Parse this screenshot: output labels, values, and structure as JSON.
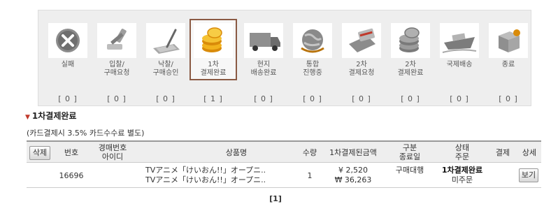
{
  "steps": [
    {
      "label": "실패",
      "count": "[ 0 ]",
      "icon": "cancel-icon"
    },
    {
      "label": "입찰/\n구매요청",
      "count": "[ 0 ]",
      "icon": "gavel-icon"
    },
    {
      "label": "낙찰/\n구매승인",
      "count": "[ 0 ]",
      "icon": "pen-tablet-icon"
    },
    {
      "label": "1차\n결제완료",
      "count": "[ 1 ]",
      "icon": "coins-icon"
    },
    {
      "label": "현지\n배송완료",
      "count": "[ 0 ]",
      "icon": "truck-icon"
    },
    {
      "label": "통합\n진행중",
      "count": "[ 0 ]",
      "icon": "globe-icon"
    },
    {
      "label": "2차\n결제요청",
      "count": "[ 0 ]",
      "icon": "card-payment-icon"
    },
    {
      "label": "2차\n결제완료",
      "count": "[ 0 ]",
      "icon": "coin-stack-icon"
    },
    {
      "label": "국제배송",
      "count": "[ 0 ]",
      "icon": "ship-icon"
    },
    {
      "label": "종료",
      "count": "[ 0 ]",
      "icon": "box-icon"
    }
  ],
  "section": {
    "title": "1차결제완료",
    "fee_note": "(카드결제시 3.5% 카드수수료 별도)"
  },
  "table": {
    "headers": {
      "delete": "삭제",
      "number": "번호",
      "auction_id": "경매번호\n아이디",
      "product": "상품명",
      "quantity": "수량",
      "paid_amount": "1차결제된금액",
      "category": "구분\n종료일",
      "status": "상태\n주문",
      "payment": "결제",
      "detail": "상세"
    },
    "rows": [
      {
        "number": "16696",
        "product_line1": "TVアニメ「けいおん!!」オープニ..",
        "product_line2": "TVアニメ「けいおん!!」オープニ..",
        "quantity": "1",
        "amount_yen": "¥ 2,520",
        "amount_won": "₩ 36,263",
        "category": "구매대행",
        "status": "1차결제완료",
        "order": "미주문",
        "view_label": "보기"
      }
    ]
  },
  "pagination": "[1]",
  "colors": {
    "active_border": "#8a5a44",
    "panel_bg": "#eeeeee",
    "title_marker": "#c0392b"
  }
}
